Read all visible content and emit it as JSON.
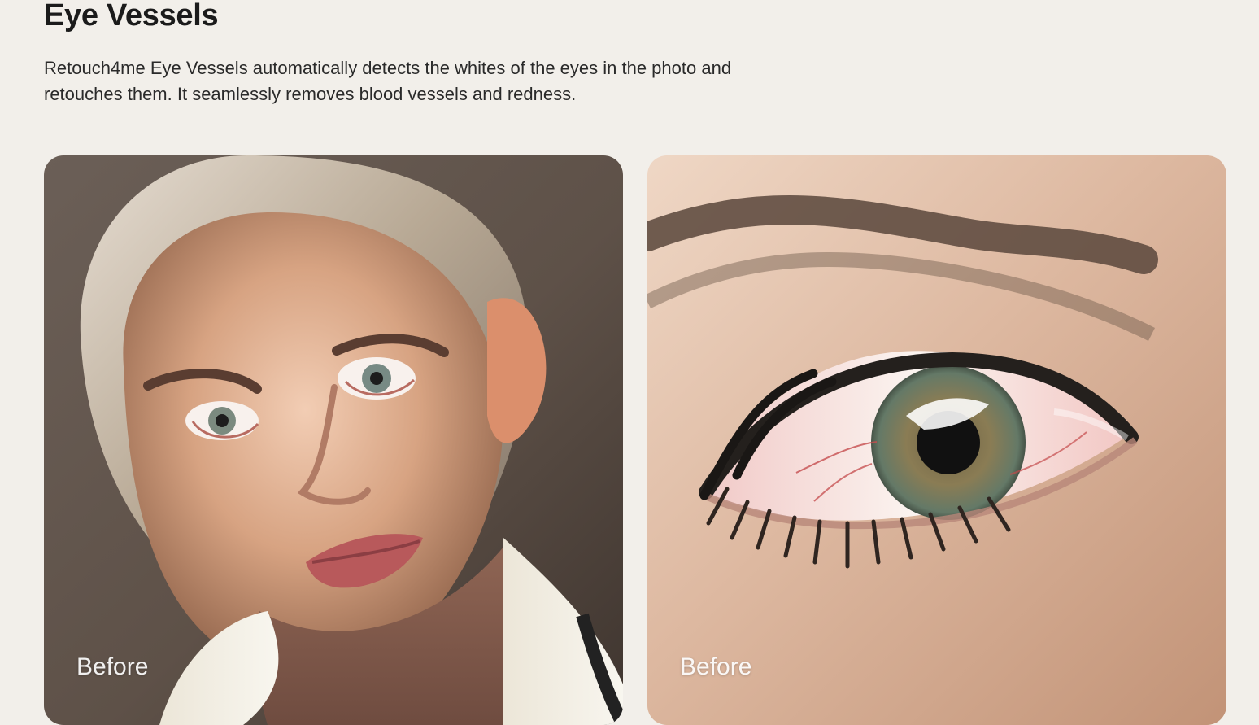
{
  "section": {
    "title": "Eye Vessels",
    "description": "Retouch4me Eye Vessels automatically detects the whites of the eyes in the photo and retouches them. It seamlessly removes blood vessels and redness."
  },
  "cards": [
    {
      "label": "Before",
      "image": "portrait-photo"
    },
    {
      "label": "Before",
      "image": "eye-closeup-photo"
    }
  ],
  "colors": {
    "page_background": "#f2efea",
    "title_text": "#1b1b1b",
    "body_text": "#2a2a2a",
    "label_text": "#ffffff"
  }
}
